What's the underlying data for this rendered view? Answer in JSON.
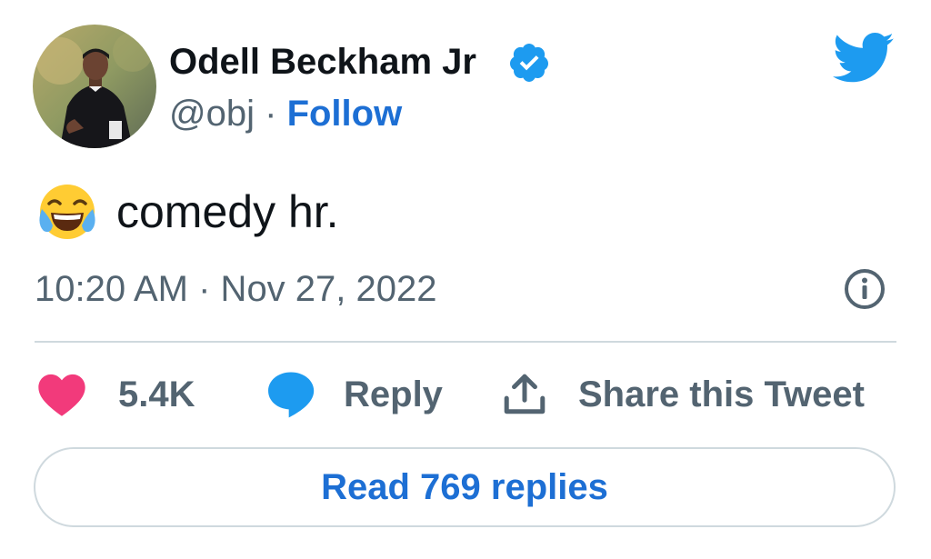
{
  "author": {
    "name": "Odell Beckham Jr",
    "handle": "@obj",
    "separator": "·",
    "follow_label": "Follow",
    "verified": true,
    "avatar_icon": "avatar-photo"
  },
  "brand": {
    "logo": "twitter-bird-icon",
    "color": "#1d9bf0"
  },
  "tweet": {
    "emoji": "😂",
    "text": "comedy hr.",
    "timestamp": "10:20 AM · Nov 27, 2022"
  },
  "actions": {
    "like_count": "5.4K",
    "reply_label": "Reply",
    "share_label": "Share this Tweet"
  },
  "footer": {
    "read_replies_label": "Read 769 replies"
  },
  "colors": {
    "text": "#0f1419",
    "secondary_text": "#536471",
    "link": "#1d6fd4",
    "like_heart": "#f23a7b",
    "reply_bubble": "#1d9bf0",
    "border": "#cfd9de"
  }
}
